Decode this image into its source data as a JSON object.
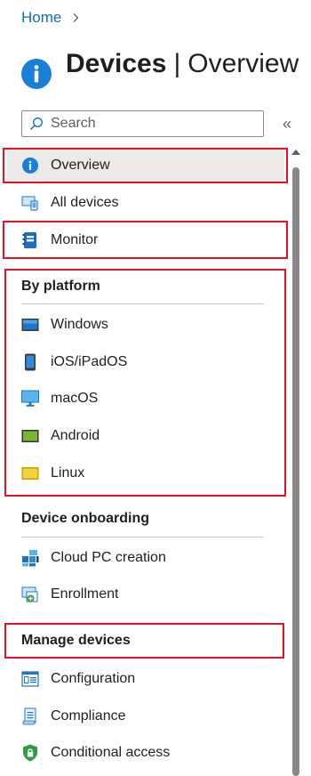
{
  "breadcrumb": {
    "home": "Home"
  },
  "header": {
    "title_strong": "Devices",
    "separator": "|",
    "title_sub": "Overview"
  },
  "search": {
    "placeholder": "Search"
  },
  "collapse_label": "«",
  "nav": {
    "overview": "Overview",
    "all_devices": "All devices",
    "monitor": "Monitor",
    "by_platform": {
      "header": "By platform",
      "windows": "Windows",
      "ios": "iOS/iPadOS",
      "macos": "macOS",
      "android": "Android",
      "linux": "Linux"
    },
    "device_onboarding": {
      "header": "Device onboarding",
      "cloud_pc": "Cloud PC creation",
      "enrollment": "Enrollment"
    },
    "manage_devices": {
      "header": "Manage devices",
      "configuration": "Configuration",
      "compliance": "Compliance",
      "conditional_access": "Conditional access"
    }
  },
  "colors": {
    "accent": "#0f6cbd",
    "highlight": "#e81123",
    "selected_bg": "#edebe9"
  }
}
